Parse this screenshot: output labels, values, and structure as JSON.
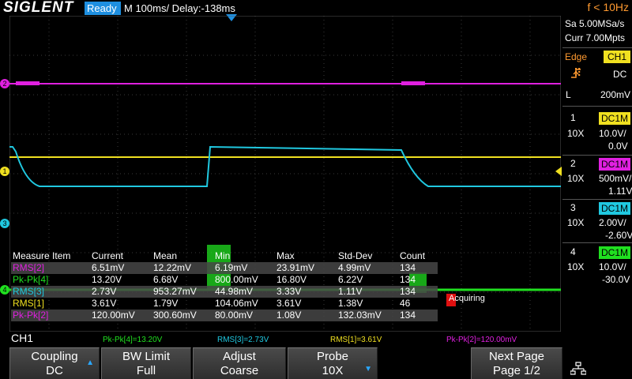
{
  "header": {
    "brand": "SIGLENT",
    "status": "Ready",
    "timebase": "M 100ms/  Delay:-138ms",
    "frequency": "f < 10Hz"
  },
  "acquisition": {
    "sample_rate": "Sa 5.00MSa/s",
    "memory_depth": "Curr 7.00Mpts"
  },
  "trigger": {
    "type": "Edge",
    "source": "CH1",
    "slope_icon": "rising-edge-icon",
    "coupling": "DC",
    "level_label": "L",
    "level": "200mV"
  },
  "channels": [
    {
      "num": "1",
      "coupling": "DC1M",
      "probe": "10X",
      "scale": "10.0V/",
      "offset": "0.0V",
      "color": "#f0e020"
    },
    {
      "num": "2",
      "coupling": "DC1M",
      "probe": "10X",
      "scale": "500mV/",
      "offset": "1.11V",
      "color": "#e020e0"
    },
    {
      "num": "3",
      "coupling": "DC1M",
      "probe": "10X",
      "scale": "2.00V/",
      "offset": "-2.60V",
      "color": "#20c8e0"
    },
    {
      "num": "4",
      "coupling": "DC1M",
      "probe": "10X",
      "scale": "10.0V/",
      "offset": "-30.0V",
      "color": "#20e020"
    }
  ],
  "measure": {
    "headers": [
      "Measure Item",
      "Current",
      "Mean",
      "Min",
      "Max",
      "Std-Dev",
      "Count"
    ],
    "rows": [
      {
        "item": "RMS[2]",
        "current": "6.51mV",
        "mean": "12.22mV",
        "min": "6.19mV",
        "max": "23.91mV",
        "std": "4.99mV",
        "count": "134",
        "color": "#e020e0"
      },
      {
        "item": "Pk-Pk[4]",
        "current": "13.20V",
        "mean": "6.68V",
        "min": "800.00mV",
        "max": "16.80V",
        "std": "6.22V",
        "count": "134",
        "color": "#20e020"
      },
      {
        "item": "RMS[3]",
        "current": "2.73V",
        "mean": "953.27mV",
        "min": "44.98mV",
        "max": "3.33V",
        "std": "1.11V",
        "count": "134",
        "color": "#20c8e0"
      },
      {
        "item": "RMS[1]",
        "current": "3.61V",
        "mean": "1.79V",
        "min": "104.06mV",
        "max": "3.61V",
        "std": "1.38V",
        "count": "46",
        "color": "#f0e020"
      },
      {
        "item": "Pk-Pk[2]",
        "current": "120.00mV",
        "mean": "300.60mV",
        "min": "80.00mV",
        "max": "1.08V",
        "std": "132.03mV",
        "count": "134",
        "color": "#e020e0"
      }
    ],
    "acquiring": "Acquiring"
  },
  "statline": {
    "ch_label": "CH1",
    "items": [
      {
        "text": "Pk-Pk[4]=13.20V",
        "color": "#20e020"
      },
      {
        "text": "RMS[3]=2.73V",
        "color": "#20c8e0"
      },
      {
        "text": "RMS[1]=3.61V",
        "color": "#f0e020"
      },
      {
        "text": "Pk-Pk[2]=120.00mV",
        "color": "#e020e0"
      }
    ]
  },
  "softkeys": [
    {
      "title": "Coupling",
      "value": "DC"
    },
    {
      "title": "BW Limit",
      "value": "Full"
    },
    {
      "title": "Adjust",
      "value": "Coarse"
    },
    {
      "title": "Probe",
      "value": "10X"
    },
    {
      "title": "Next Page",
      "value": "Page 1/2"
    }
  ],
  "markers": {
    "ch2": "2",
    "ch1": "1",
    "ch3": "3",
    "ch4": "4"
  }
}
